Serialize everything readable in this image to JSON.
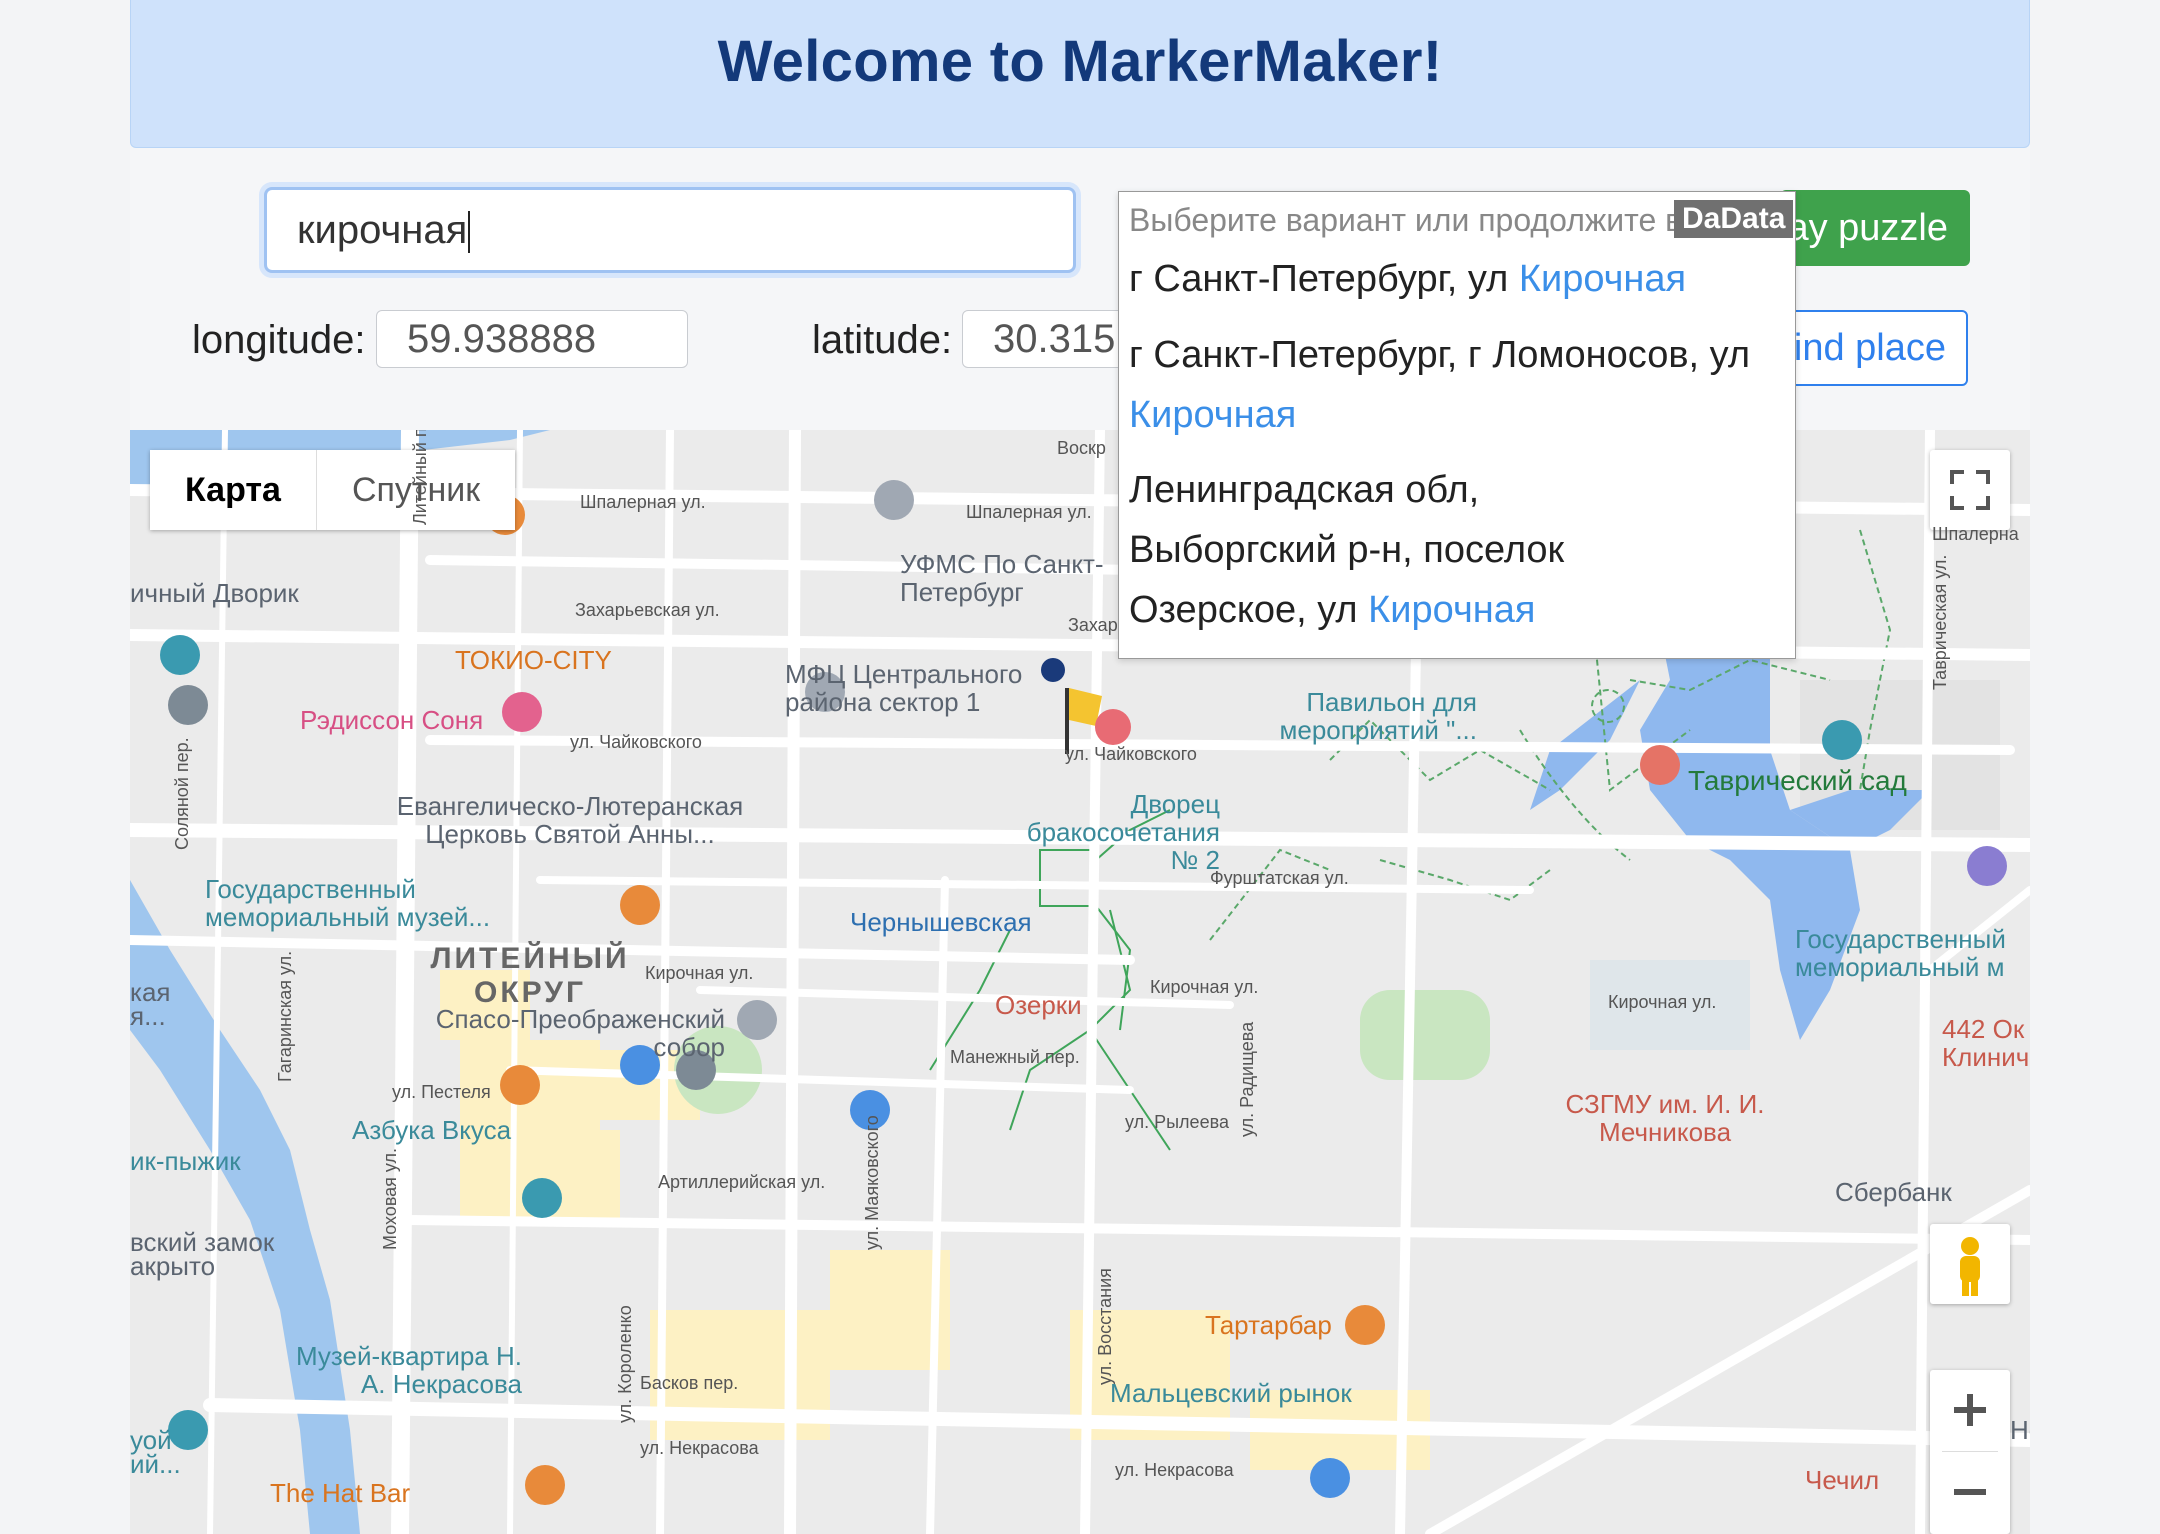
{
  "header": {
    "title": "Welcome to MarkerMaker!"
  },
  "form": {
    "address_value": "кирочная",
    "longitude_label": "longitude:",
    "longitude_value": "59.938888",
    "latitude_label": "latitude:",
    "latitude_value": "30.315",
    "green_button_label": "ay puzzle",
    "find_button_label": "find place"
  },
  "suggestions": {
    "hint": "Выберите вариант или продолжите ввод",
    "badge": "DaData",
    "items": [
      {
        "prefix": "г Санкт-Петербург, ул ",
        "match": "Кирочная"
      },
      {
        "prefix": "г Санкт-Петербург, г Ломоносов, ул ",
        "match": "Кирочная"
      },
      {
        "prefix": "Ленинградская обл, Выборгский р-н, поселок Озерское, ул ",
        "match": "Кирочная"
      }
    ]
  },
  "map": {
    "type_tabs": [
      "Карта",
      "Спутник"
    ],
    "active_tab": "Карта",
    "labels": {
      "dvorik": "ичный Дворик",
      "tokio": "ТОКИО-CITY",
      "radisson": "Рэдиссон Соня",
      "ufms": "УФМС По Санкт-Петербург",
      "mfc": "МФЦ Центрального района сектор 1",
      "pavilion": "Павильон для мероприятий \"...",
      "tavr_sad": "Таврический сад",
      "church_anna": "Евангелическо-Лютеранская Церковь Святой Анны...",
      "dvorec": "Дворец бракосочетания № 2",
      "museum_left": "Государственный мемориальный музей...",
      "museum_right": "Государственный мемориальный м",
      "chernyshevskaya": "Чернышевская",
      "ozerki": "Озерки",
      "district": "ЛИТЕЙНЫЙ ОКРУГ",
      "sobor": "Спасо-Преображенский собор",
      "azbuka": "Азбука Вкуса",
      "chizhik": "ик-пыжик",
      "zamok": "вский замок акрыто",
      "muzey_nekrasova": "Музей-квартира Н. А. Некрасова",
      "hat_bar": "The Hat Bar",
      "tartarbar": "Тартарбар",
      "maltsev": "Мальцевский рынок",
      "szgmu": "СЗГМУ им. И. И. Мечникова",
      "sberbank": "Сбербанк",
      "clinic": "442 Ок Клинич",
      "chechil": "Чечил",
      "kaya": "кая я...",
      "uoy": "уой ий...",
      "voskr": "Воскр",
      "zaxar": "Захар",
      "shpalern": "Шпалерна",
      "ne": "Не"
    },
    "streets": {
      "shpalernaya1": "Шпалерная ул.",
      "shpalernaya2": "Шпалерная ул.",
      "zaharyevskaya": "Захарьевская ул.",
      "chaykovskogo1": "ул. Чайковского",
      "chaykovskogo2": "ул. Чайковского",
      "furshtatskaya": "Фурштатская ул.",
      "kirochnaya1": "Кирочная ул.",
      "kirochnaya2": "Кирочная ул.",
      "kirochnaya3": "Кирочная ул.",
      "manezhny": "Манежный пер.",
      "pestelya": "ул. Пестеля",
      "ryleeva": "ул. Рылеева",
      "artilleriyskaya": "Артиллерийская ул.",
      "baskov": "Басков пер.",
      "nekrasova1": "ул. Некрасова",
      "nekrasova2": "ул. Некрасова",
      "liteyny": "Литейный пр.",
      "mayakovskogo": "ул. Маяковского",
      "vosstaniya": "ул. Восстания",
      "radishcheva": "ул. Радищева",
      "solyanoy": "Соляной пер.",
      "gagarinskaya": "Гагаринская ул.",
      "mokhovaya": "Моховая ул.",
      "korolenko": "ул. Короленко",
      "tavricheskaya": "Таврическая ул."
    }
  },
  "colors": {
    "banner_bg": "#cfe2fb",
    "title": "#13397a",
    "highlight": "#3b8fe8",
    "green_button": "#3fa24c",
    "outline_button": "#2f80ed"
  }
}
